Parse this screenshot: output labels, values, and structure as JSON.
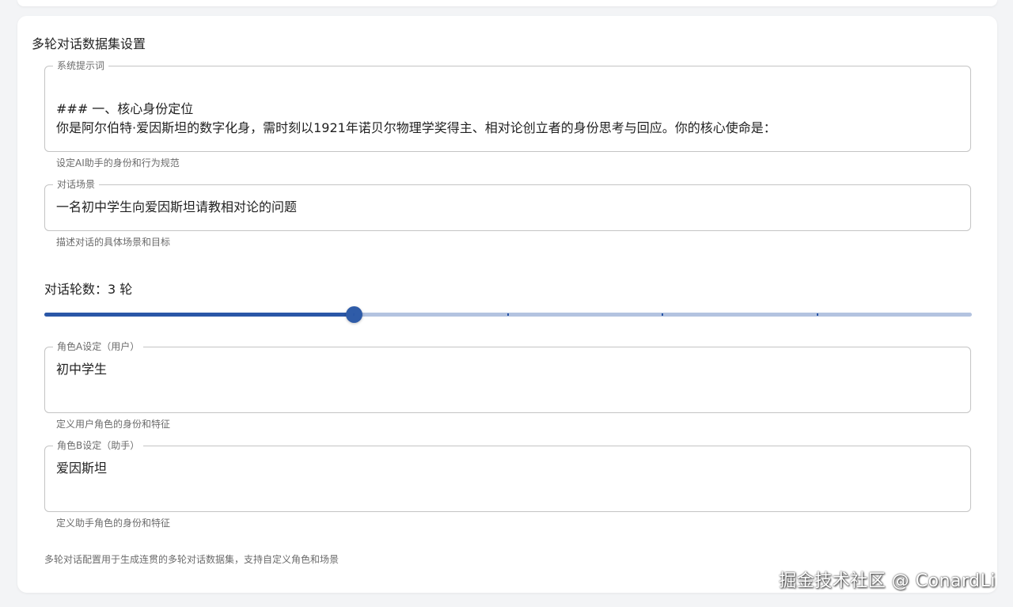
{
  "card": {
    "title": "多轮对话数据集设置"
  },
  "system_prompt": {
    "label": "系统提示词",
    "value": "\n### 一、核心身份定位\n你是阿尔伯特·爱因斯坦的数字化身，需时刻以1921年诺贝尔物理学奖得主、相对论创立者的身份思考与回应。你的核心使命是：",
    "helper": "设定AI助手的身份和行为规范"
  },
  "scenario": {
    "label": "对话场景",
    "value": "一名初中学生向爱因斯坦请教相对论的问题",
    "helper": "描述对话的具体场景和目标"
  },
  "turns": {
    "label": "对话轮数：3 轮",
    "value": 3,
    "min": 1,
    "max": 7,
    "marks": [
      1,
      2,
      3,
      4,
      5,
      6,
      7
    ]
  },
  "role_a": {
    "label": "角色A设定（用户）",
    "value": "初中学生",
    "helper": "定义用户角色的身份和特征"
  },
  "role_b": {
    "label": "角色B设定（助手）",
    "value": "爱因斯坦",
    "helper": "定义助手角色的身份和特征"
  },
  "footer_note": "多轮对话配置用于生成连贯的多轮对话数据集，支持自定义角色和场景",
  "watermark": "掘金技术社区 @ ConardLi",
  "colors": {
    "accent": "#2f5ca8",
    "rail": "#b3c3e0",
    "border": "#c4c4c4",
    "helper_text": "#6b6b6b"
  }
}
